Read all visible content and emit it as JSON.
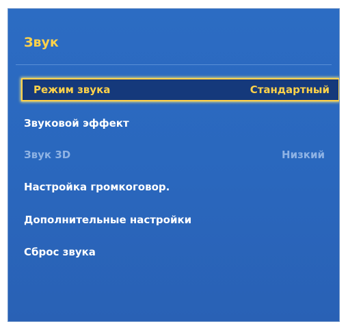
{
  "colors": {
    "panel_background": "#2a67bd",
    "title": "#ffd24a",
    "selected_text": "#ffd24a",
    "selected_background": "#15397b",
    "selected_border": "#ffd24a",
    "item_text": "#ffffff",
    "disabled_text": "#8fb3e4"
  },
  "panel": {
    "title": "Звук"
  },
  "menu": {
    "items": [
      {
        "label": "Режим звука",
        "value": "Стандартный",
        "selected": true,
        "disabled": false
      },
      {
        "label": "Звуковой эффект",
        "value": "",
        "selected": false,
        "disabled": false
      },
      {
        "label": "Звук 3D",
        "value": "Низкий",
        "selected": false,
        "disabled": true
      },
      {
        "label": "Настройка громкоговор.",
        "value": "",
        "selected": false,
        "disabled": false
      },
      {
        "label": "Дополнительные настройки",
        "value": "",
        "selected": false,
        "disabled": false
      },
      {
        "label": "Сброс звука",
        "value": "",
        "selected": false,
        "disabled": false
      }
    ]
  }
}
